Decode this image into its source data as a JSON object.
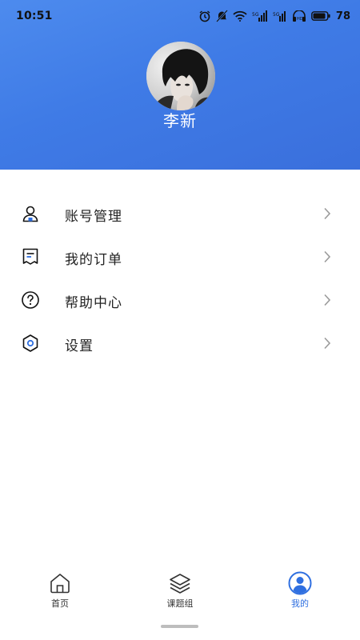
{
  "status_bar": {
    "time": "10:51",
    "battery": "78"
  },
  "profile": {
    "name": "李新"
  },
  "menu": {
    "items": [
      {
        "label": "账号管理",
        "icon": "user-account-icon"
      },
      {
        "label": "我的订单",
        "icon": "order-receipt-icon"
      },
      {
        "label": "帮助中心",
        "icon": "help-question-icon"
      },
      {
        "label": "设置",
        "icon": "settings-hexagon-icon"
      }
    ]
  },
  "tabs": [
    {
      "label": "首页",
      "icon": "home-icon",
      "active": false
    },
    {
      "label": "课题组",
      "icon": "layers-icon",
      "active": false
    },
    {
      "label": "我的",
      "icon": "profile-icon",
      "active": true
    }
  ],
  "colors": {
    "header_start": "#4d8bee",
    "header_end": "#3a6fdc",
    "accent": "#2f6fe0",
    "text": "#222222"
  }
}
